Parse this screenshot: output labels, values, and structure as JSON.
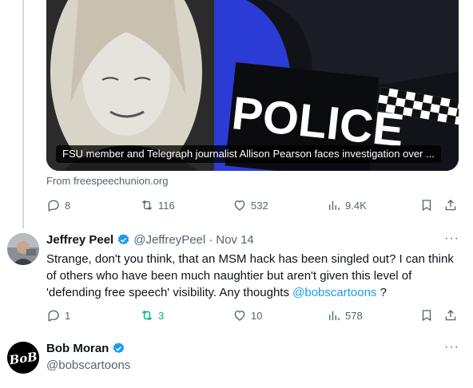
{
  "card": {
    "caption": "FSU member and Telegraph journalist Allison Pearson faces investigation over ...",
    "police_text": "POLICE",
    "source": "From freespeechunion.org"
  },
  "tweet1_actions": {
    "replies": "8",
    "reposts": "116",
    "likes": "532",
    "views": "9.4K"
  },
  "reply": {
    "name": "Jeffrey Peel",
    "handle": "@JeffreyPeel",
    "separator": "·",
    "date": "Nov 14",
    "more": "···",
    "text_before": "Strange, don't you think, that an MSM hack has been singled out? I can think of others who have been much naughtier but aren't given this level of 'defending free speech' visibility.  Any thoughts ",
    "mention": "@bobscartoons",
    "text_after": " ?",
    "actions": {
      "replies": "1",
      "reposts": "3",
      "likes": "10",
      "views": "578"
    }
  },
  "next": {
    "name": "Bob Moran",
    "handle": "@bobscartoons",
    "more": "···",
    "avatar_text": "BoB"
  },
  "colors": {
    "accent": "#1d9bf0",
    "repost_active": "#00ba7c",
    "muted": "#536471"
  }
}
